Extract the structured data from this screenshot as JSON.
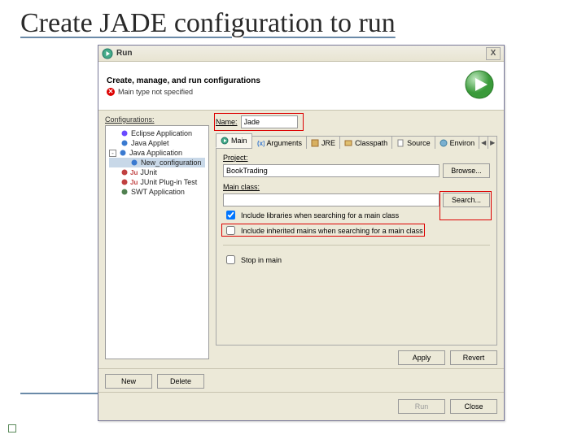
{
  "slide": {
    "title": "Create JADE configuration to run"
  },
  "dialog": {
    "title": "Run",
    "banner_title": "Create, manage, and run configurations",
    "banner_error": "Main type not specified",
    "close_x": "X"
  },
  "configs": {
    "label": "Configurations:",
    "items": [
      {
        "label": "Eclipse Application",
        "icon": "eclipse",
        "expand": ""
      },
      {
        "label": "Java Applet",
        "icon": "applet",
        "expand": ""
      },
      {
        "label": "Java Application",
        "icon": "java-app",
        "expand": "-"
      },
      {
        "label": "New_configuration",
        "icon": "java-app",
        "expand": "",
        "indent": 1,
        "selected": true
      },
      {
        "label": "JUnit",
        "icon": "junit",
        "expand": ""
      },
      {
        "label": "JUnit Plug-in Test",
        "icon": "junit",
        "expand": ""
      },
      {
        "label": "SWT Application",
        "icon": "swt",
        "expand": ""
      }
    ]
  },
  "name_field": {
    "label": "Name:",
    "value": "Jade"
  },
  "tabs": {
    "items": [
      {
        "label": "Main",
        "icon": "main",
        "active": true
      },
      {
        "label": "Arguments",
        "icon": "args"
      },
      {
        "label": "JRE",
        "icon": "jre"
      },
      {
        "label": "Classpath",
        "icon": "classpath"
      },
      {
        "label": "Source",
        "icon": "source"
      },
      {
        "label": "Environ",
        "icon": "env"
      }
    ]
  },
  "main_tab": {
    "project_label": "Project:",
    "project_value": "BookTrading",
    "browse_label": "Browse...",
    "mainclass_label": "Main class:",
    "mainclass_value": "",
    "search_label": "Search...",
    "include_libs_label": "Include libraries when searching for a main class",
    "include_libs_checked": true,
    "include_inherited_label": "Include inherited mains when searching for a main class",
    "include_inherited_checked": false,
    "stop_main_label": "Stop in main",
    "stop_main_checked": false
  },
  "buttons": {
    "new_label": "New",
    "delete_label": "Delete",
    "apply_label": "Apply",
    "revert_label": "Revert",
    "run_label": "Run",
    "close_label": "Close"
  }
}
